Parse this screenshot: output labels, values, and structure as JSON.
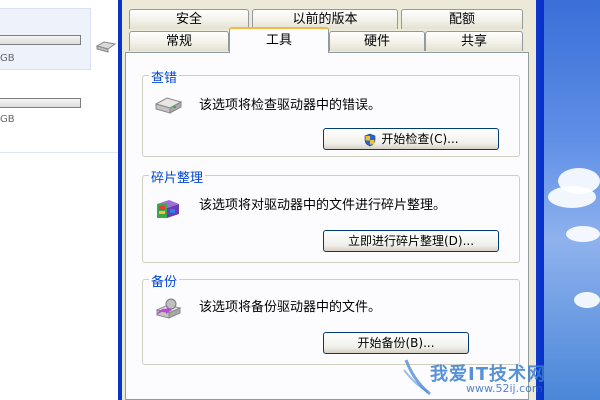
{
  "left_pane": {
    "drives": [
      {
        "capacity_text": "GB"
      },
      {
        "capacity_text": "GB"
      }
    ]
  },
  "tabs": {
    "row_top": [
      "安全",
      "以前的版本",
      "配额"
    ],
    "row_bottom": [
      "常规",
      "工具",
      "硬件",
      "共享"
    ],
    "active": "工具"
  },
  "sections": {
    "check": {
      "title": "查错",
      "description": "该选项将检查驱动器中的错误。",
      "button": "开始检查(C)..."
    },
    "defrag": {
      "title": "碎片整理",
      "description": "该选项将对驱动器中的文件进行碎片整理。",
      "button": "立即进行碎片整理(D)..."
    },
    "backup": {
      "title": "备份",
      "description": "该选项将备份驱动器中的文件。",
      "button": "开始备份(B)..."
    }
  },
  "watermark": {
    "text": "我爱IT技术网",
    "url": "www.52ij.com"
  },
  "colors": {
    "group_title": "#0046d5",
    "dialog_bg": "#ece9d8",
    "page_bg": "#fcfcfe",
    "window_frame": "#1f5ce8"
  },
  "icons": {
    "check": "hard-drive-icon",
    "defrag": "defrag-icon",
    "backup": "backup-icon",
    "uac": "uac-shield-icon"
  }
}
